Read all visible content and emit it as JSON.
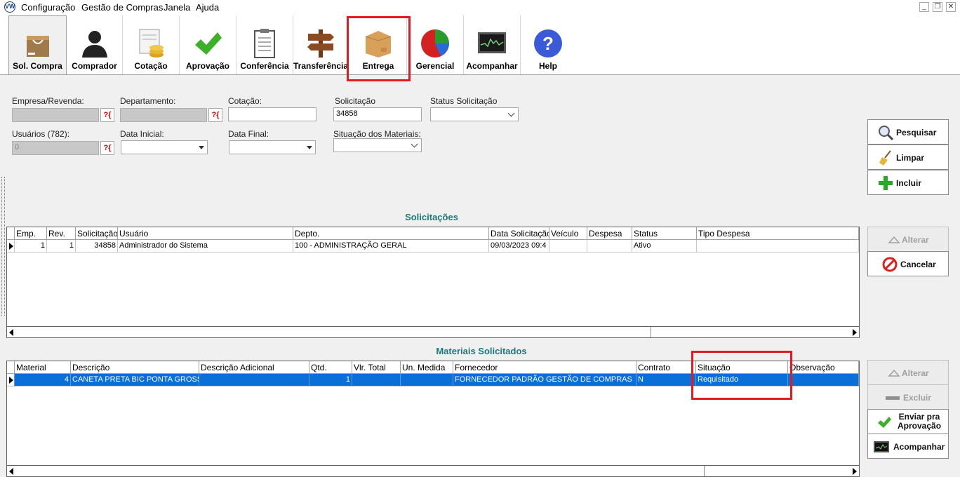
{
  "menu": [
    "Configuração",
    "Gestão de Compras",
    "Janela",
    "Ajuda"
  ],
  "toolbar": [
    {
      "label": "Sol. Compra",
      "icon": "shopping-bag-icon"
    },
    {
      "label": "Comprador",
      "icon": "person-silhouette-icon"
    },
    {
      "label": "Cotação",
      "icon": "coins-document-icon"
    },
    {
      "label": "Aprovação",
      "icon": "green-check-icon"
    },
    {
      "label": "Conferência",
      "icon": "clipboard-icon"
    },
    {
      "label": "Transferência",
      "icon": "signpost-icon"
    },
    {
      "label": "Entrega",
      "icon": "package-box-icon"
    },
    {
      "label": "Gerencial",
      "icon": "pie-chart-icon"
    },
    {
      "label": "Acompanhar",
      "icon": "monitor-graph-icon"
    },
    {
      "label": "Help",
      "icon": "help-question-icon"
    }
  ],
  "form": {
    "empresa_label": "Empresa/Revenda:",
    "departamento_label": "Departamento:",
    "cotacao_label": "Cotação:",
    "cotacao_value": "",
    "solicitacao_label": "Solicitação",
    "solicitacao_value": "34858",
    "status_label": "Status Solicitação",
    "usuarios_label": "Usuários (782):",
    "usuarios_value": "0",
    "data_inicial_label": "Data Inicial:",
    "data_final_label": "Data Final:",
    "situacao_label": "Situação dos Materiais:"
  },
  "actions": {
    "pesquisar": "Pesquisar",
    "limpar": "Limpar",
    "incluir": "Incluir",
    "alterar": "Alterar",
    "cancelar": "Cancelar",
    "alterar2": "Alterar",
    "excluir": "Excluir",
    "enviar_line1": "Enviar pra",
    "enviar_line2": "Aprovação",
    "acompanhar": "Acompanhar"
  },
  "solicitacoes": {
    "title": "Solicitações",
    "columns": [
      "Emp.",
      "Rev.",
      "Solicitação",
      "Usuário",
      "Depto.",
      "Data Solicitação",
      "Veículo",
      "Despesa",
      "Status",
      "Tipo Despesa"
    ],
    "rows": [
      [
        "1",
        "1",
        "34858",
        "Administrador do Sistema",
        "100 - ADMINISTRAÇÃO GERAL",
        "09/03/2023 09:4",
        "",
        "",
        "Ativo",
        ""
      ]
    ]
  },
  "materiais": {
    "title": "Materiais Solicitados",
    "columns": [
      "Material",
      "Descrição",
      "Descrição Adicional",
      "Qtd.",
      "Vlr. Total",
      "Un. Medida",
      "Fornecedor",
      "Contrato",
      "Situação",
      "Observação"
    ],
    "rows": [
      [
        "4",
        "CANETA PRETA BIC PONTA GROSSA",
        "",
        "1",
        "",
        "",
        "FORNECEDOR PADRÃO GESTÃO DE COMPRAS",
        "N",
        "Requisitado",
        ""
      ]
    ]
  },
  "colors": {
    "highlight_red": "#e21b23",
    "selection_blue": "#0a6fd6",
    "title_teal": "#1a7a7a"
  }
}
